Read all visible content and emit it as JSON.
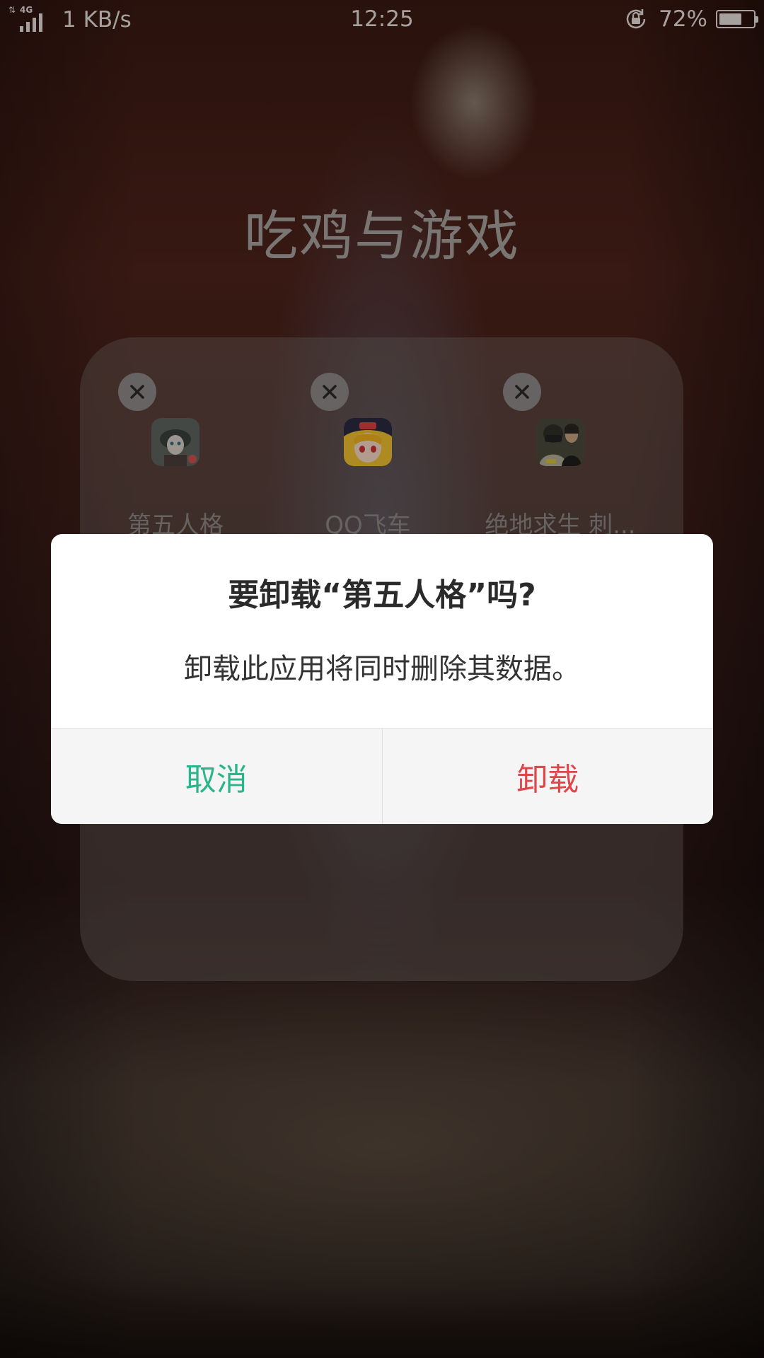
{
  "status_bar": {
    "network_type": "4G",
    "net_speed": "1 KB/s",
    "time": "12:25",
    "battery_percent": "72%",
    "battery_level": 0.72,
    "icons": [
      "signal-icon",
      "rotation-lock-icon",
      "battery-icon"
    ]
  },
  "folder": {
    "title": "吃鸡与游戏",
    "apps": [
      {
        "label": "第五人格",
        "icon": "identity-v-app-icon"
      },
      {
        "label": "QQ飞车",
        "icon": "qq-speed-app-icon"
      },
      {
        "label": "绝地求生 刺...",
        "icon": "pubg-app-icon"
      }
    ]
  },
  "dialog": {
    "title": "要卸载“第五人格”吗?",
    "message": "卸载此应用将同时删除其数据。",
    "cancel_label": "取消",
    "confirm_label": "卸载",
    "colors": {
      "cancel": "#2bb58a",
      "confirm": "#e0474a"
    }
  }
}
